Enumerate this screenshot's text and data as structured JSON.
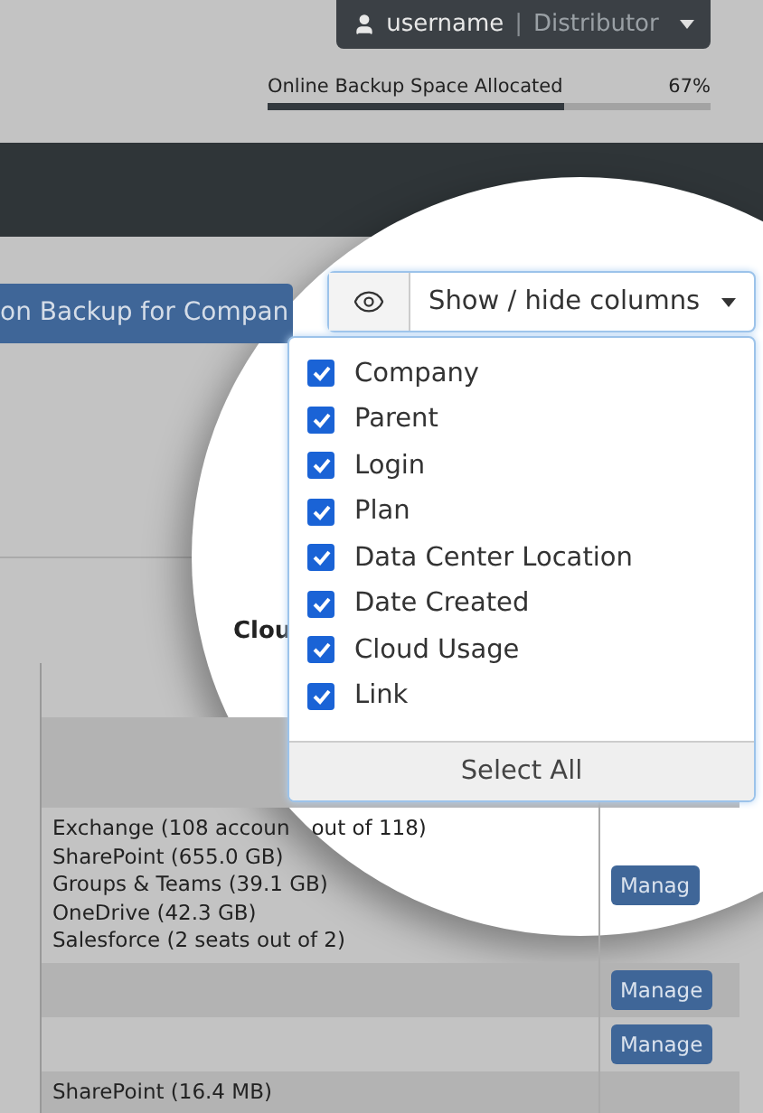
{
  "user_menu": {
    "username": "username",
    "separator": "|",
    "role": "Distributor"
  },
  "allocation": {
    "label": "Online Backup Space Allocated",
    "reading": "67%",
    "level": 0.67
  },
  "action_button": "on Backup for Compan",
  "column_toggle": {
    "label": "Show / hide columns",
    "expanded": true,
    "footer": "Select All",
    "options": [
      {
        "label": "Company",
        "checked": true
      },
      {
        "label": "Parent",
        "checked": true
      },
      {
        "label": "Login",
        "checked": true
      },
      {
        "label": "Plan",
        "checked": true
      },
      {
        "label": "Data Center Location",
        "checked": true
      },
      {
        "label": "Date Created",
        "checked": true
      },
      {
        "label": "Cloud Usage",
        "checked": true
      },
      {
        "label": "Link",
        "checked": true
      }
    ]
  },
  "table": {
    "columns": [
      "Clou"
    ],
    "rows": [
      {
        "usage": [],
        "link": ""
      },
      {
        "usage": [],
        "link": ""
      },
      {
        "usage": [
          "Exchange (108 accoun",
          "SharePoint (655.0 GB)",
          "Groups & Teams (39.1 GB)",
          "OneDrive (42.3 GB)",
          "Salesforce (2 seats out of 2)"
        ],
        "usage_tail": "out of 118)",
        "link": "Manag"
      },
      {
        "usage": [],
        "link": "Manage"
      },
      {
        "usage": [],
        "link": "Manage"
      },
      {
        "usage": [
          "SharePoint (16.4 MB)"
        ],
        "link": ""
      }
    ]
  }
}
